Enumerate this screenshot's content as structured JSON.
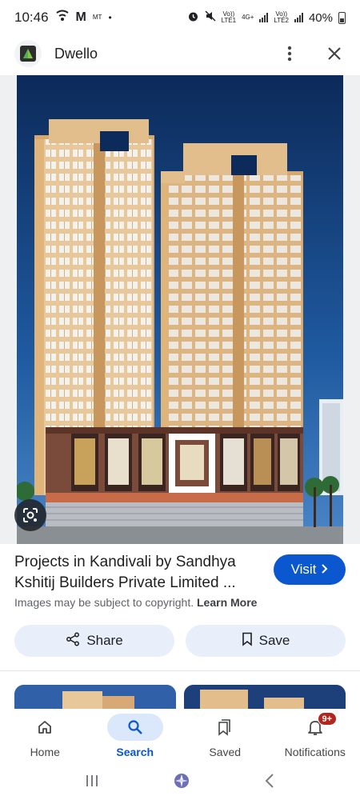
{
  "status_bar": {
    "time": "10:46",
    "carrier_small": "MT",
    "volte1": "Vo))",
    "lte1": "LTE1",
    "net": "4G+",
    "volte2": "Vo))",
    "lte2": "LTE2",
    "battery": "40%"
  },
  "header": {
    "app_name": "Dwello",
    "more_icon": "more-vert-icon",
    "close_icon": "close-icon"
  },
  "result": {
    "title_line1": "Projects in Kandivali by Sandhya",
    "title_line2": "Kshitij Builders Private Limited ...",
    "visit_label": "Visit",
    "copyright_text": "Images may be subject to copyright.",
    "learn_more": "Learn More"
  },
  "actions": {
    "share_label": "Share",
    "save_label": "Save"
  },
  "bottom_nav": {
    "items": [
      {
        "label": "Home",
        "icon": "home-icon"
      },
      {
        "label": "Search",
        "icon": "search-icon"
      },
      {
        "label": "Saved",
        "icon": "bookmark-icon"
      },
      {
        "label": "Notifications",
        "icon": "bell-icon",
        "badge": "9+"
      }
    ]
  },
  "colors": {
    "accent": "#0b57d0",
    "pill_bg": "#e8effa",
    "badge": "#b3261e"
  }
}
